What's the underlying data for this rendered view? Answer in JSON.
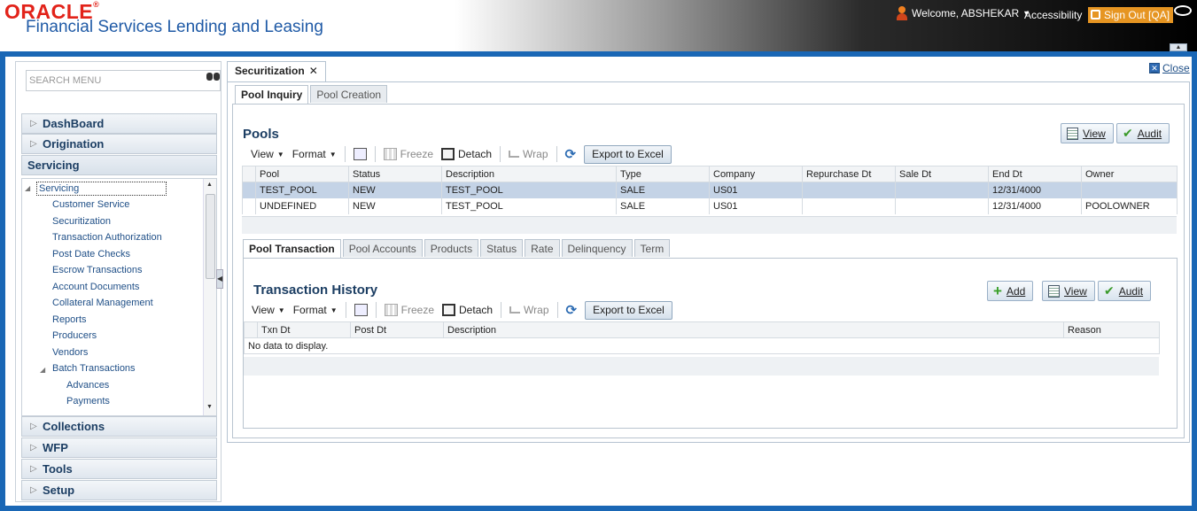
{
  "header": {
    "brand": "ORACLE",
    "product": "Financial Services Lending and Leasing",
    "welcome": "Welcome, ABSHEKAR",
    "accessibility": "Accessibility",
    "signout": "Sign Out [QA]"
  },
  "nav": {
    "search_placeholder": "SEARCH MENU",
    "top_items": [
      "DashBoard",
      "Origination"
    ],
    "open_section": "Servicing",
    "tree": {
      "root": "Servicing",
      "items": [
        "Customer Service",
        "Securitization",
        "Transaction Authorization",
        "Post Date Checks",
        "Escrow Transactions",
        "Account Documents",
        "Collateral Management",
        "Reports",
        "Producers",
        "Vendors"
      ],
      "batch": "Batch Transactions",
      "batch_items": [
        "Advances",
        "Payments"
      ]
    },
    "bottom_items": [
      "Collections",
      "WFP",
      "Tools",
      "Setup"
    ]
  },
  "main_tab": {
    "label": "Securitization",
    "close_link": "Close"
  },
  "pool_tabs": [
    "Pool Inquiry",
    "Pool Creation"
  ],
  "pools": {
    "title": "Pools",
    "buttons": {
      "view": "View",
      "audit": "Audit"
    },
    "toolbar": {
      "view": "View",
      "format": "Format",
      "freeze": "Freeze",
      "detach": "Detach",
      "wrap": "Wrap",
      "export": "Export to Excel"
    },
    "columns": [
      "Pool",
      "Status",
      "Description",
      "Type",
      "Company",
      "Repurchase Dt",
      "Sale Dt",
      "End Dt",
      "Owner"
    ],
    "rows": [
      [
        "TEST_POOL",
        "NEW",
        "TEST_POOL",
        "SALE",
        "US01",
        "",
        "",
        "12/31/4000",
        ""
      ],
      [
        "UNDEFINED",
        "NEW",
        "TEST_POOL",
        "SALE",
        "US01",
        "",
        "",
        "12/31/4000",
        "POOLOWNER"
      ]
    ]
  },
  "detail_tabs": [
    "Pool Transaction",
    "Pool Accounts",
    "Products",
    "Status",
    "Rate",
    "Delinquency",
    "Term"
  ],
  "transactions": {
    "title": "Transaction History",
    "buttons": {
      "add": "Add",
      "view": "View",
      "audit": "Audit"
    },
    "toolbar": {
      "view": "View",
      "format": "Format",
      "freeze": "Freeze",
      "detach": "Detach",
      "wrap": "Wrap",
      "export": "Export to Excel"
    },
    "columns": [
      "Txn Dt",
      "Post Dt",
      "Description",
      "Reason"
    ],
    "empty_message": "No data to display."
  }
}
